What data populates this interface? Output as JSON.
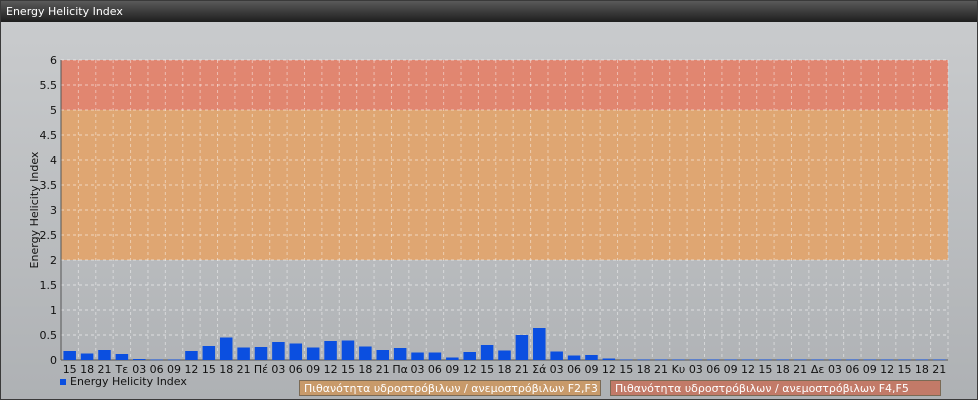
{
  "window": {
    "title": "Energy Helicity Index"
  },
  "legend": {
    "series_label": "Energy Helicity Index",
    "series_color": "#0b4fe0"
  },
  "bands": [
    {
      "label": "Πιθανότητα υδροστρόβιλων / ανεμοστρόβιλων F2,F3",
      "from": 2,
      "to": 5,
      "color": "#e0a46e"
    },
    {
      "label": "Πιθανότητα υδροστρόβιλων / ανεμοστρόβιλων F4,F5",
      "from": 5,
      "to": 6,
      "color": "#e3836c"
    }
  ],
  "chart_data": {
    "type": "bar",
    "title": "",
    "xlabel": "",
    "ylabel": "Energy Helicity Index",
    "ylim": [
      0,
      6
    ],
    "yticks": [
      "0",
      "0.5",
      "1",
      "1.5",
      "2",
      "2.5",
      "3",
      "3.5",
      "4",
      "4.5",
      "5",
      "5.5",
      "6"
    ],
    "grid": true,
    "legend_position": "bottom-left",
    "categories": [
      "15",
      "18",
      "21",
      "Τε",
      "03",
      "06",
      "09",
      "12",
      "15",
      "18",
      "21",
      "Πέ",
      "03",
      "06",
      "09",
      "12",
      "15",
      "18",
      "21",
      "Πα",
      "03",
      "06",
      "09",
      "12",
      "15",
      "18",
      "21",
      "Σά",
      "03",
      "06",
      "09",
      "12",
      "15",
      "18",
      "21",
      "Κυ",
      "03",
      "06",
      "09",
      "12",
      "15",
      "18",
      "21",
      "Δε",
      "03",
      "06",
      "09",
      "12",
      "15",
      "18",
      "21"
    ],
    "series": [
      {
        "name": "Energy Helicity Index",
        "values": [
          0.18,
          0.13,
          0.2,
          0.12,
          0.02,
          0.01,
          0.01,
          0.18,
          0.28,
          0.45,
          0.25,
          0.26,
          0.36,
          0.33,
          0.25,
          0.38,
          0.39,
          0.27,
          0.2,
          0.24,
          0.15,
          0.15,
          0.05,
          0.16,
          0.3,
          0.19,
          0.5,
          0.64,
          0.17,
          0.09,
          0.1,
          0.03,
          0.01,
          0.01,
          0.01,
          0.01,
          0.01,
          0.01,
          0.01,
          0.01,
          0.01,
          0.01,
          0.01,
          0.01,
          0.01,
          0.01,
          0.01,
          0.01,
          0.01,
          0.01,
          0.01
        ]
      }
    ]
  }
}
